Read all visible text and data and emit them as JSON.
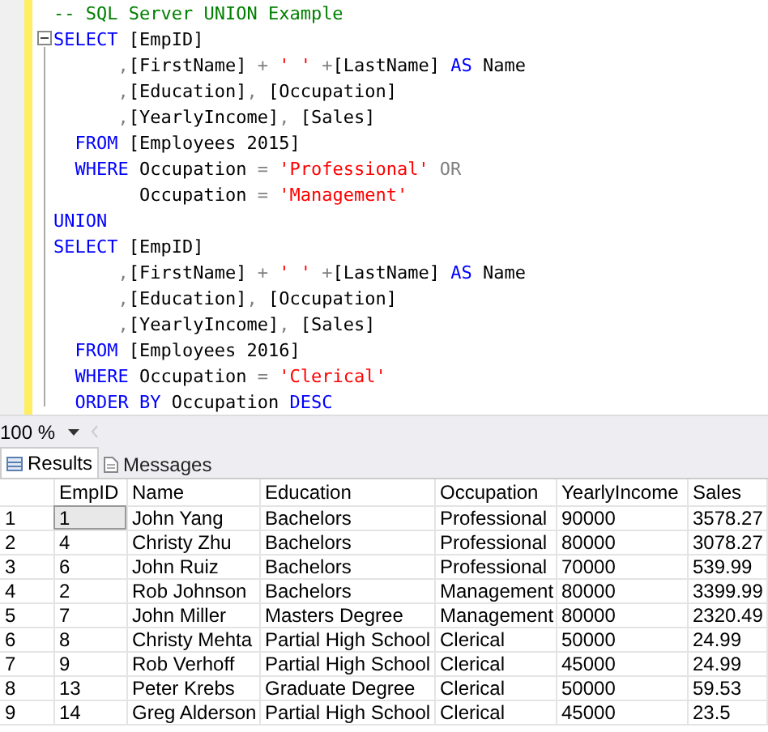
{
  "editor": {
    "lines": [
      [
        {
          "kind": "comment",
          "text": "-- SQL Server UNION Example"
        }
      ],
      [
        {
          "kind": "keyword",
          "text": "SELECT"
        },
        {
          "kind": "plain",
          "text": " [EmpID]"
        }
      ],
      [
        {
          "kind": "operator",
          "text": "      ,"
        },
        {
          "kind": "plain",
          "text": "[FirstName] "
        },
        {
          "kind": "operator",
          "text": "+ "
        },
        {
          "kind": "string",
          "text": "' '"
        },
        {
          "kind": "operator",
          "text": " +"
        },
        {
          "kind": "plain",
          "text": "[LastName] "
        },
        {
          "kind": "keyword",
          "text": "AS"
        },
        {
          "kind": "plain",
          "text": " Name"
        }
      ],
      [
        {
          "kind": "operator",
          "text": "      ,"
        },
        {
          "kind": "plain",
          "text": "[Education]"
        },
        {
          "kind": "operator",
          "text": ","
        },
        {
          "kind": "plain",
          "text": " [Occupation]"
        }
      ],
      [
        {
          "kind": "operator",
          "text": "      ,"
        },
        {
          "kind": "plain",
          "text": "[YearlyIncome]"
        },
        {
          "kind": "operator",
          "text": ","
        },
        {
          "kind": "plain",
          "text": " [Sales]"
        }
      ],
      [
        {
          "kind": "keyword",
          "text": "  FROM"
        },
        {
          "kind": "plain",
          "text": " [Employees 2015]"
        }
      ],
      [
        {
          "kind": "keyword",
          "text": "  WHERE"
        },
        {
          "kind": "plain",
          "text": " Occupation "
        },
        {
          "kind": "operator",
          "text": "= "
        },
        {
          "kind": "string",
          "text": "'Professional'"
        },
        {
          "kind": "operator",
          "text": " OR"
        }
      ],
      [
        {
          "kind": "plain",
          "text": "        Occupation "
        },
        {
          "kind": "operator",
          "text": "= "
        },
        {
          "kind": "string",
          "text": "'Management'"
        }
      ],
      [
        {
          "kind": "keyword",
          "text": "UNION"
        }
      ],
      [
        {
          "kind": "keyword",
          "text": "SELECT"
        },
        {
          "kind": "plain",
          "text": " [EmpID]"
        }
      ],
      [
        {
          "kind": "operator",
          "text": "      ,"
        },
        {
          "kind": "plain",
          "text": "[FirstName] "
        },
        {
          "kind": "operator",
          "text": "+ "
        },
        {
          "kind": "string",
          "text": "' '"
        },
        {
          "kind": "operator",
          "text": " +"
        },
        {
          "kind": "plain",
          "text": "[LastName] "
        },
        {
          "kind": "keyword",
          "text": "AS"
        },
        {
          "kind": "plain",
          "text": " Name"
        }
      ],
      [
        {
          "kind": "operator",
          "text": "      ,"
        },
        {
          "kind": "plain",
          "text": "[Education]"
        },
        {
          "kind": "operator",
          "text": ","
        },
        {
          "kind": "plain",
          "text": " [Occupation]"
        }
      ],
      [
        {
          "kind": "operator",
          "text": "      ,"
        },
        {
          "kind": "plain",
          "text": "[YearlyIncome]"
        },
        {
          "kind": "operator",
          "text": ","
        },
        {
          "kind": "plain",
          "text": " [Sales]"
        }
      ],
      [
        {
          "kind": "keyword",
          "text": "  FROM"
        },
        {
          "kind": "plain",
          "text": " [Employees 2016]"
        }
      ],
      [
        {
          "kind": "keyword",
          "text": "  WHERE"
        },
        {
          "kind": "plain",
          "text": " Occupation "
        },
        {
          "kind": "operator",
          "text": "= "
        },
        {
          "kind": "string",
          "text": "'Clerical'"
        }
      ],
      [
        {
          "kind": "keyword",
          "text": "  ORDER BY"
        },
        {
          "kind": "plain",
          "text": " Occupation "
        },
        {
          "kind": "keyword",
          "text": "DESC"
        }
      ]
    ]
  },
  "zoom": {
    "value": "100 %"
  },
  "tabs": [
    {
      "label": "Results",
      "selected": true
    },
    {
      "label": "Messages",
      "selected": false
    }
  ],
  "table": {
    "columns": [
      "EmpID",
      "Name",
      "Education",
      "Occupation",
      "YearlyIncome",
      "Sales"
    ],
    "rows": [
      {
        "number": "1",
        "selected": true,
        "cells": [
          "1",
          "John Yang",
          "Bachelors",
          "Professional",
          "90000",
          "3578.27"
        ]
      },
      {
        "number": "2",
        "selected": false,
        "cells": [
          "4",
          "Christy Zhu",
          "Bachelors",
          "Professional",
          "80000",
          "3078.27"
        ]
      },
      {
        "number": "3",
        "selected": false,
        "cells": [
          "6",
          "John Ruiz",
          "Bachelors",
          "Professional",
          "70000",
          "539.99"
        ]
      },
      {
        "number": "4",
        "selected": false,
        "cells": [
          "2",
          "Rob Johnson",
          "Bachelors",
          "Management",
          "80000",
          "3399.99"
        ]
      },
      {
        "number": "5",
        "selected": false,
        "cells": [
          "7",
          "John Miller",
          "Masters Degree",
          "Management",
          "80000",
          "2320.49"
        ]
      },
      {
        "number": "6",
        "selected": false,
        "cells": [
          "8",
          "Christy Mehta",
          "Partial High School",
          "Clerical",
          "50000",
          "24.99"
        ]
      },
      {
        "number": "7",
        "selected": false,
        "cells": [
          "9",
          "Rob Verhoff",
          "Partial High School",
          "Clerical",
          "45000",
          "24.99"
        ]
      },
      {
        "number": "8",
        "selected": false,
        "cells": [
          "13",
          "Peter Krebs",
          "Graduate Degree",
          "Clerical",
          "50000",
          "59.53"
        ]
      },
      {
        "number": "9",
        "selected": false,
        "cells": [
          "14",
          "Greg Alderson",
          "Partial High School",
          "Clerical",
          "45000",
          "23.5"
        ]
      }
    ]
  }
}
